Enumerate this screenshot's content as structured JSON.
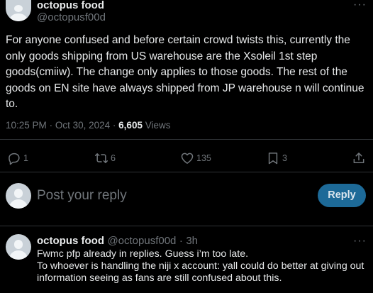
{
  "tweet": {
    "author_name": "octopus food",
    "author_handle": "@octopusf00d",
    "more_label": "···",
    "text": "For anyone confused and before certain crowd twists this, currently the only goods shipping from US warehouse are the Xsoleil 1st step goods(cmiiw). The change only applies to those goods. The rest of the goods on EN site have always shipped from JP warehouse n will continue to.",
    "time": "10:25 PM",
    "separator": "·",
    "date": "Oct 30, 2024",
    "views_count": "6,605",
    "views_label": "Views"
  },
  "actions": {
    "replies": "1",
    "reposts": "6",
    "likes": "135",
    "bookmarks": "3"
  },
  "reply_box": {
    "placeholder": "Post your reply",
    "button_label": "Reply"
  },
  "comment": {
    "author_name": "octopus food",
    "author_handle": "@octopusf00d",
    "separator": "·",
    "time": "3h",
    "more_label": "···",
    "line1": "Fwmc pfp already in replies. Guess i’m too late.",
    "line2": "To whoever is handling the niji x account: yall could do better at giving out information seeing as fans are still confused about this."
  },
  "colors": {
    "background": "#000000",
    "text_primary": "#e7e9ea",
    "text_secondary": "#71767b",
    "reply_button": "#1d6a98",
    "divider": "#2f3336"
  },
  "icons": [
    "reply-icon",
    "repost-icon",
    "like-icon",
    "bookmark-icon",
    "share-icon",
    "more-icon",
    "avatar"
  ]
}
